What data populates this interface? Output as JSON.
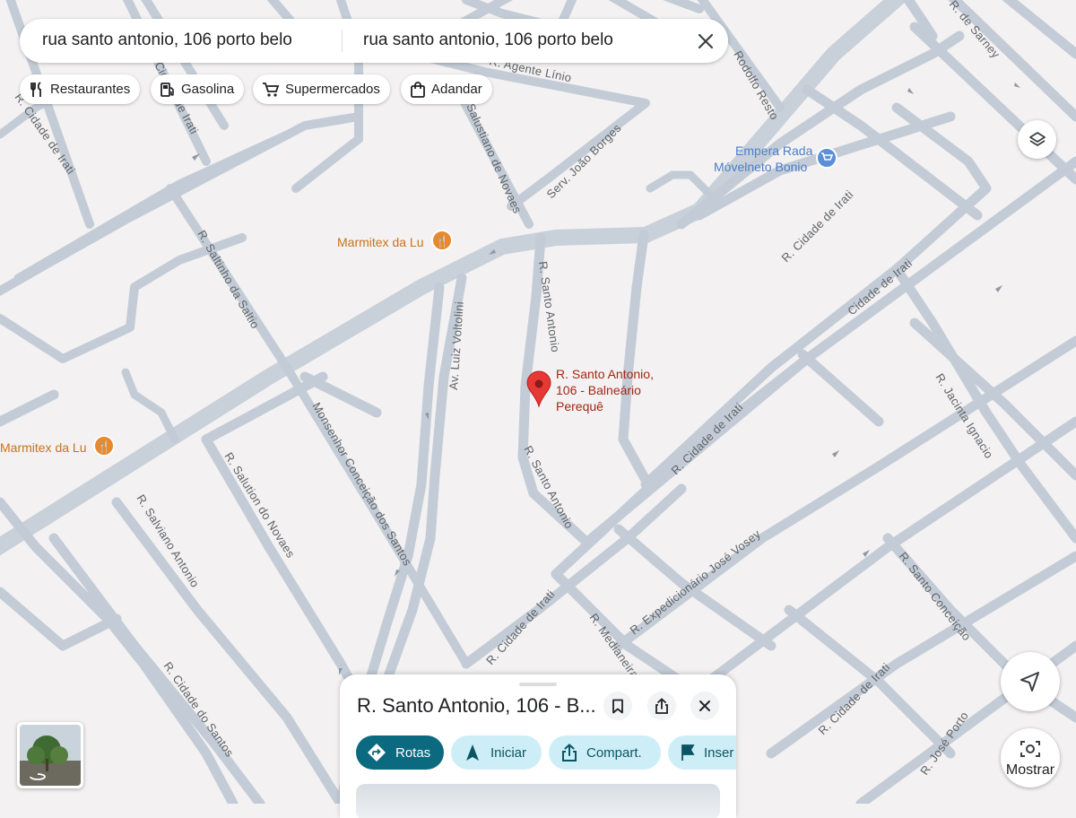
{
  "search": {
    "origin": "rua santo antonio, 106 porto belo",
    "destination": "rua santo antonio, 106 porto belo"
  },
  "chips": [
    {
      "label": "Restaurantes",
      "icon": "fork-knife-icon"
    },
    {
      "label": "Gasolina",
      "icon": "gas-pump-icon"
    },
    {
      "label": "Supermercados",
      "icon": "cart-icon"
    },
    {
      "label": "Adandar",
      "icon": "shopping-bag-icon"
    }
  ],
  "map": {
    "streets": {
      "agente_linio": "R. Agente Línio",
      "salustiano": "Salustiano de Novaes",
      "joao_borges": "Serv. João Borges",
      "rodolfo": "Rodolfo Resto",
      "cidade_irati_top": "R. Cidade de Irati",
      "cidade_irati_mid": "R. Cidade de Irati",
      "cidade_irati_bot": "R. Cidade de Irati",
      "cidade_irati_br": "R. Cidade de Irati",
      "cidade_irati_left": "R. Cidade de Irati",
      "santo_antonio_n": "R. Santo Antonio",
      "santo_antonio_s": "R. Santo Antonio",
      "luiz_voltolini": "Av. Luiz Voltolini",
      "saltinho": "R. Saltinho da Saltio",
      "salution_novaes": "R. Salution do Novaes",
      "salviano": "R. Salviano Antonio",
      "cidade_santos": "R. Cidade do Santos",
      "monsenhor": "Monsenhor Conceição dos Santos",
      "medianeira": "R. Medianeira",
      "expedicionario": "R. Expedicionário José Vosey",
      "santo_conceicao": "R. Santo Conceição",
      "jose_pereira": "R. José Porto",
      "cidade_de_irati_far": "Cidade de Irati",
      "jacinta": "R. Jacinta Ignacio",
      "sarney": "R. de Sarney",
      "cidade_irati_corner": "Cidade de Irati"
    },
    "pois": {
      "marmitex_1": "Marmitex da Lu",
      "marmitex_2": "Marmitex da Lu",
      "empera_line1": "Empera Rada",
      "empera_line2": "Móvelneto Bonio"
    },
    "pin": {
      "line1": "R. Santo Antonio,",
      "line2": "106 - Balneário",
      "line3": "Perequê"
    }
  },
  "controls": {
    "layers_icon": "layers-icon",
    "recenter_icon": "navigation-arrow-icon",
    "mostrar_label": "Mostrar"
  },
  "sheet": {
    "title": "R. Santo Antonio, 106 - B...",
    "actions": [
      {
        "label": "Rotas",
        "icon": "directions-icon"
      },
      {
        "label": "Iniciar",
        "icon": "navigation-icon"
      },
      {
        "label": "Compart.",
        "icon": "share-icon"
      },
      {
        "label": "Inser",
        "icon": "flag-icon"
      }
    ]
  },
  "colors": {
    "map_bg": "#f3f1f1",
    "road": "#c3ccd6",
    "pin": "#e53935",
    "pin_text": "#a52714",
    "poi_food": "#c5741f",
    "poi_shop": "#4a7fc9",
    "primary_action": "#0b6a7f"
  }
}
